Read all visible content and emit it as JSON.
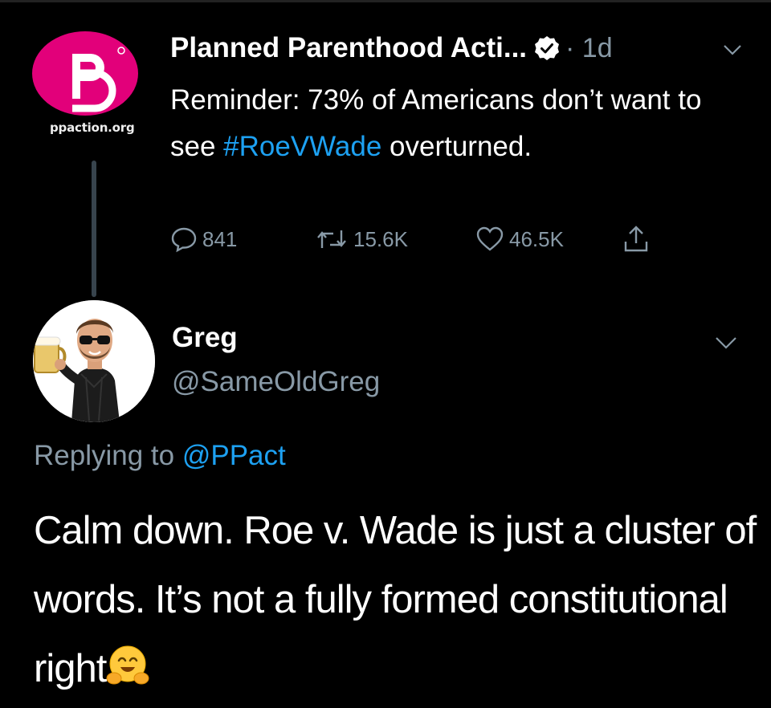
{
  "parent_tweet": {
    "avatar_caption": "ppaction.org",
    "name": "Planned Parenthood Acti...",
    "time": "· 1d",
    "text_before": "Reminder: 73% of Americans don’t want to see ",
    "hashtag": "#RoeVWade",
    "text_after": " overturned.",
    "replies": "841",
    "retweets": "15.6K",
    "likes": "46.5K",
    "icons": [
      "verified-badge-icon",
      "chevron-down-icon",
      "reply-icon",
      "retweet-icon",
      "like-icon",
      "share-icon"
    ]
  },
  "reply_tweet": {
    "name": "Greg",
    "handle": "@SameOldGreg",
    "replying_prefix": "Replying to ",
    "replying_mention": "@PPact",
    "text": "Calm down. Roe v. Wade is just a cluster of words. It’s not a fully formed constitutional right",
    "emoji": "hugging-face-emoji"
  },
  "colors": {
    "background": "#000000",
    "accent": "#1da1f2",
    "muted": "#8899a6",
    "pp_pink": "#e2007a"
  }
}
